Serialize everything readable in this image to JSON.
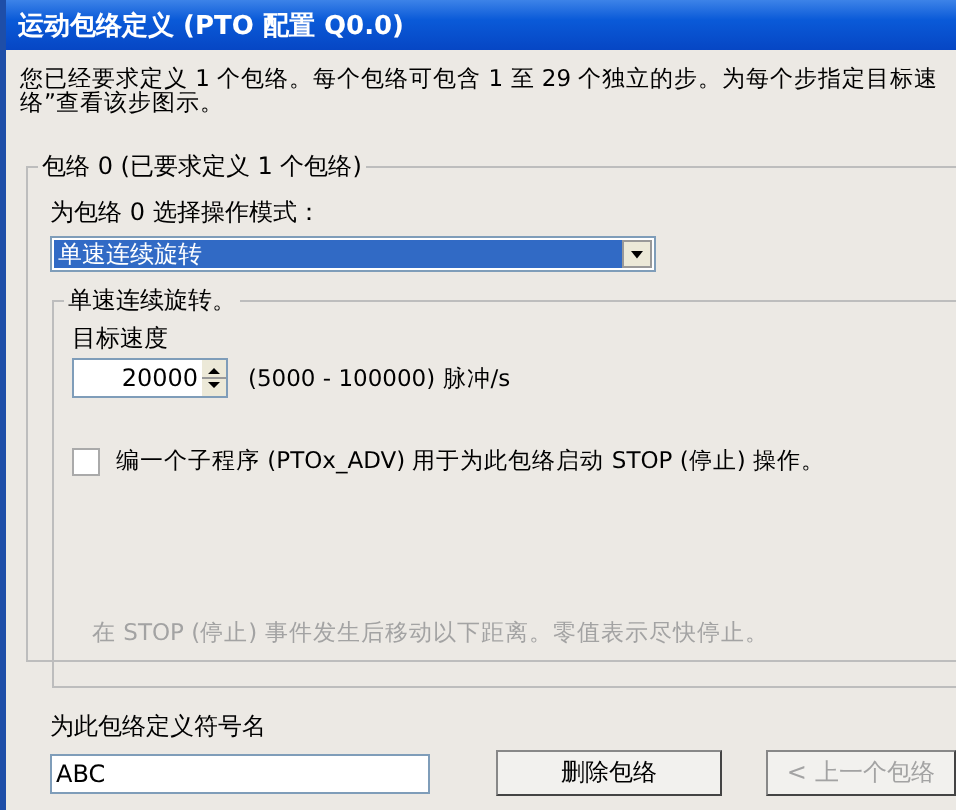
{
  "window": {
    "title": "运动包络定义 (PTO 配置 Q0.0)"
  },
  "intro_lines": [
    "您已经要求定义 1 个包络。每个包络可包含 1 至 29 个独立的步。为每个步指定目标速",
    "络”查看该步图示。"
  ],
  "envelope_group": {
    "title": "包络 0 (已要求定义 1 个包络)",
    "mode_label": "为包络 0 选择操作模式：",
    "mode_select": {
      "value": "单速连续旋转",
      "focused": true
    },
    "mode_group": {
      "title": "单速连续旋转。",
      "speed_label": "目标速度",
      "speed_value": "20000",
      "speed_range": "(5000 - 100000) 脉冲/s",
      "stop_checkbox": {
        "label": "编一个子程序 (PTOx_ADV) 用于为此包络启动 STOP (停止) 操作。",
        "checked": false
      },
      "stop_note": {
        "text": "在 STOP (停止) 事件发生后移动以下距离。零值表示尽快停止。",
        "disabled": true
      }
    }
  },
  "symbol_label": "为此包络定义符号名",
  "symbol_value": "ABC",
  "buttons": [
    {
      "label": "删除包络",
      "disabled": false
    },
    {
      "label": "< 上一个包络",
      "disabled": true
    }
  ]
}
